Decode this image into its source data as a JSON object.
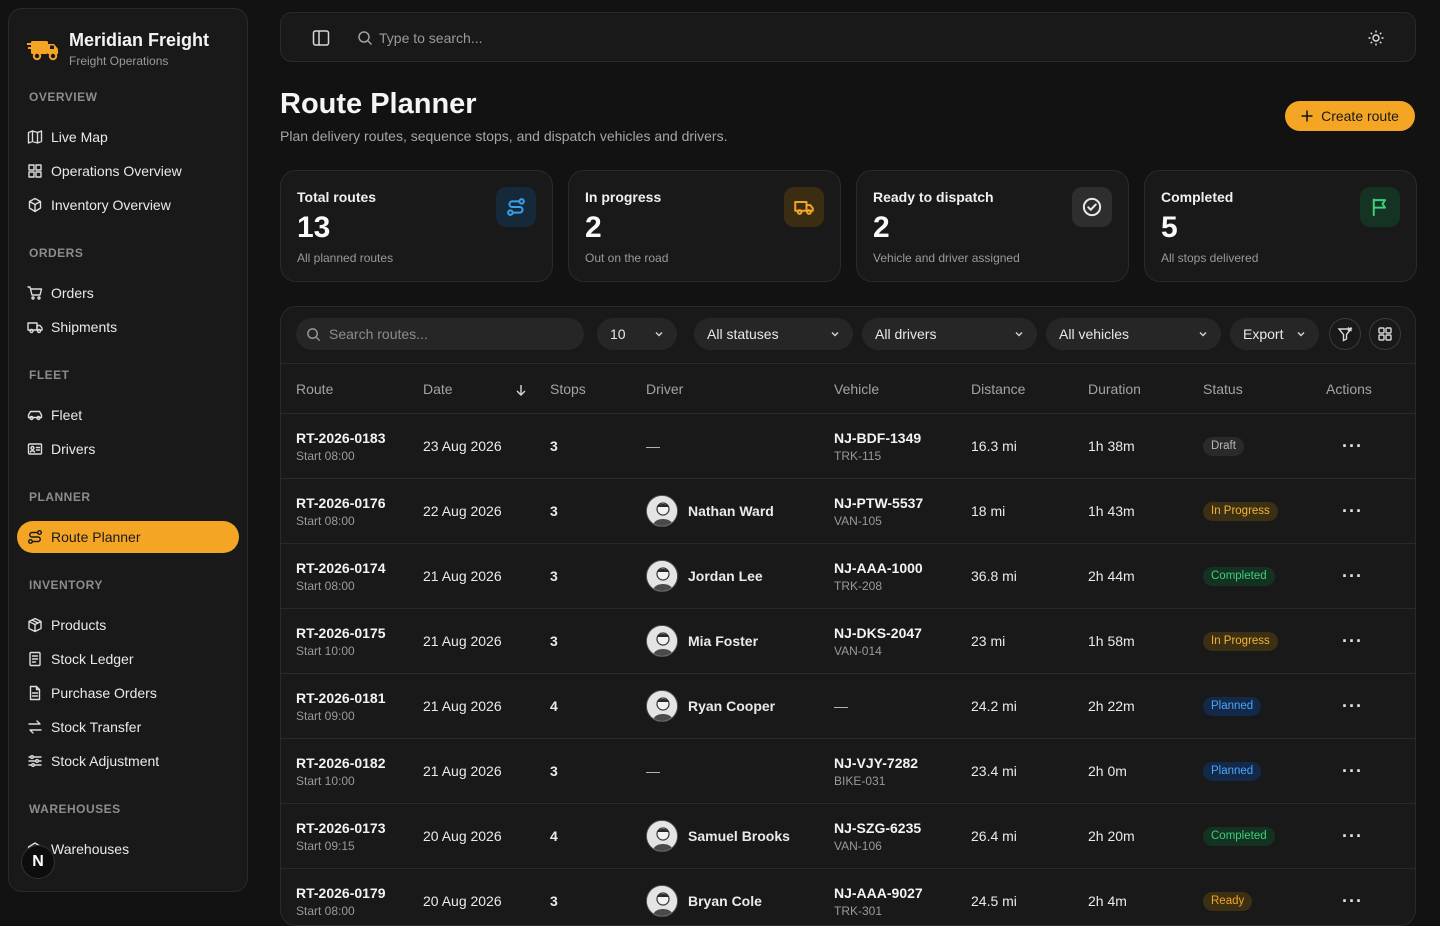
{
  "brand": {
    "name": "Meridian Freight",
    "subtitle": "Freight Operations"
  },
  "sidebar": {
    "sections": [
      {
        "title": "OVERVIEW",
        "items": [
          {
            "label": "Live Map",
            "icon": "map-icon"
          },
          {
            "label": "Operations Overview",
            "icon": "grid-icon"
          },
          {
            "label": "Inventory Overview",
            "icon": "boxes-icon"
          }
        ]
      },
      {
        "title": "ORDERS",
        "items": [
          {
            "label": "Orders",
            "icon": "cart-icon"
          },
          {
            "label": "Shipments",
            "icon": "truck-icon"
          }
        ]
      },
      {
        "title": "FLEET",
        "items": [
          {
            "label": "Fleet",
            "icon": "car-icon"
          },
          {
            "label": "Drivers",
            "icon": "id-card-icon"
          }
        ]
      },
      {
        "title": "PLANNER",
        "items": [
          {
            "label": "Route Planner",
            "icon": "route-icon",
            "active": true
          }
        ]
      },
      {
        "title": "INVENTORY",
        "items": [
          {
            "label": "Products",
            "icon": "package-icon"
          },
          {
            "label": "Stock Ledger",
            "icon": "ledger-icon"
          },
          {
            "label": "Purchase Orders",
            "icon": "document-icon"
          },
          {
            "label": "Stock Transfer",
            "icon": "transfer-icon"
          },
          {
            "label": "Stock Adjustment",
            "icon": "sliders-icon"
          }
        ]
      },
      {
        "title": "WAREHOUSES",
        "items": [
          {
            "label": "Warehouses",
            "icon": "warehouse-icon"
          }
        ]
      }
    ],
    "user_initial": "N"
  },
  "topbar": {
    "search_placeholder": "Type to search..."
  },
  "page": {
    "title": "Route Planner",
    "subtitle": "Plan delivery routes, sequence stops, and dispatch vehicles and drivers.",
    "create_label": "Create route"
  },
  "stats": [
    {
      "label": "Total routes",
      "value": "13",
      "desc": "All planned routes",
      "icon": "route-icon",
      "color": "#3aa0e8",
      "bg": "#15293a"
    },
    {
      "label": "In progress",
      "value": "2",
      "desc": "Out on the road",
      "icon": "truck-icon",
      "color": "#f5a524",
      "bg": "#3a2d12"
    },
    {
      "label": "Ready to dispatch",
      "value": "2",
      "desc": "Vehicle and driver assigned",
      "icon": "check-circle-icon",
      "color": "#e8e8e8",
      "bg": "#2e2e2e"
    },
    {
      "label": "Completed",
      "value": "5",
      "desc": "All stops delivered",
      "icon": "flag-icon",
      "color": "#3ecf7a",
      "bg": "#153323"
    }
  ],
  "filters": {
    "search_placeholder": "Search routes...",
    "page_size": "10",
    "status": "All statuses",
    "driver": "All drivers",
    "vehicle": "All vehicles",
    "export_label": "Export"
  },
  "table": {
    "headers": {
      "route": "Route",
      "date": "Date",
      "stops": "Stops",
      "driver": "Driver",
      "vehicle": "Vehicle",
      "distance": "Distance",
      "duration": "Duration",
      "status": "Status",
      "actions": "Actions"
    },
    "rows": [
      {
        "id": "RT-2026-0183",
        "start": "Start 08:00",
        "date": "23 Aug 2026",
        "stops": "3",
        "driver": "—",
        "plate": "NJ-BDF-1349",
        "unit": "TRK-115",
        "distance": "16.3 mi",
        "duration": "1h 38m",
        "status": "Draft"
      },
      {
        "id": "RT-2026-0176",
        "start": "Start 08:00",
        "date": "22 Aug 2026",
        "stops": "3",
        "driver": "Nathan Ward",
        "plate": "NJ-PTW-5537",
        "unit": "VAN-105",
        "distance": "18 mi",
        "duration": "1h 43m",
        "status": "In Progress"
      },
      {
        "id": "RT-2026-0174",
        "start": "Start 08:00",
        "date": "21 Aug 2026",
        "stops": "3",
        "driver": "Jordan Lee",
        "plate": "NJ-AAA-1000",
        "unit": "TRK-208",
        "distance": "36.8 mi",
        "duration": "2h 44m",
        "status": "Completed"
      },
      {
        "id": "RT-2026-0175",
        "start": "Start 10:00",
        "date": "21 Aug 2026",
        "stops": "3",
        "driver": "Mia Foster",
        "plate": "NJ-DKS-2047",
        "unit": "VAN-014",
        "distance": "23 mi",
        "duration": "1h 58m",
        "status": "In Progress"
      },
      {
        "id": "RT-2026-0181",
        "start": "Start 09:00",
        "date": "21 Aug 2026",
        "stops": "4",
        "driver": "Ryan Cooper",
        "plate": "—",
        "unit": "",
        "distance": "24.2 mi",
        "duration": "2h 22m",
        "status": "Planned"
      },
      {
        "id": "RT-2026-0182",
        "start": "Start 10:00",
        "date": "21 Aug 2026",
        "stops": "3",
        "driver": "—",
        "plate": "NJ-VJY-7282",
        "unit": "BIKE-031",
        "distance": "23.4 mi",
        "duration": "2h 0m",
        "status": "Planned"
      },
      {
        "id": "RT-2026-0173",
        "start": "Start 09:15",
        "date": "20 Aug 2026",
        "stops": "4",
        "driver": "Samuel Brooks",
        "plate": "NJ-SZG-6235",
        "unit": "VAN-106",
        "distance": "26.4 mi",
        "duration": "2h 20m",
        "status": "Completed"
      },
      {
        "id": "RT-2026-0179",
        "start": "Start 08:00",
        "date": "20 Aug 2026",
        "stops": "3",
        "driver": "Bryan Cole",
        "plate": "NJ-AAA-9027",
        "unit": "TRK-301",
        "distance": "24.5 mi",
        "duration": "2h 4m",
        "status": "Ready"
      }
    ],
    "actions_glyph": "···"
  }
}
